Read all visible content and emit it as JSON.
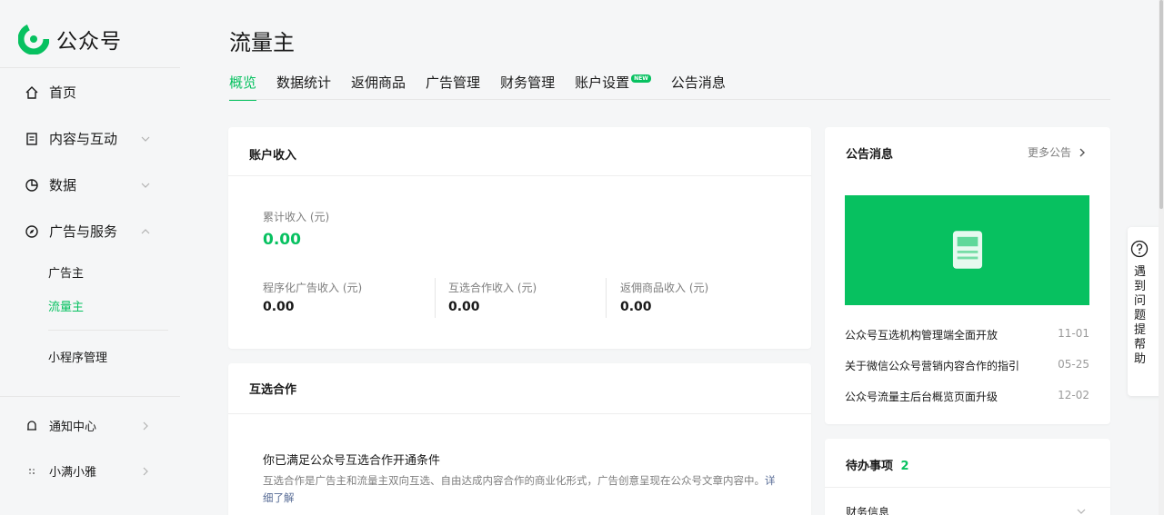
{
  "app": {
    "name": "公众号"
  },
  "sidebar": {
    "items": [
      {
        "label": "首页",
        "icon": "home-icon"
      },
      {
        "label": "内容与互动",
        "icon": "document-icon"
      },
      {
        "label": "数据",
        "icon": "pie-chart-icon"
      },
      {
        "label": "广告与服务",
        "icon": "compass-icon"
      }
    ],
    "sub_items": [
      {
        "label": "广告主",
        "active": false
      },
      {
        "label": "流量主",
        "active": true
      },
      {
        "label": "小程序管理",
        "active": false
      }
    ],
    "bottom_items": [
      {
        "label": "通知中心",
        "icon": "bell-icon"
      },
      {
        "label": "小满小雅",
        "icon": "avatar-icon"
      }
    ]
  },
  "header": {
    "title": "流量主",
    "tabs": [
      {
        "label": "概览",
        "active": true
      },
      {
        "label": "数据统计"
      },
      {
        "label": "返佣商品"
      },
      {
        "label": "广告管理"
      },
      {
        "label": "财务管理"
      },
      {
        "label": "账户设置",
        "badge": "NEW"
      },
      {
        "label": "公告消息"
      }
    ]
  },
  "income": {
    "title": "账户收入",
    "total_label": "累计收入 (元)",
    "total_value": "0.00",
    "items": [
      {
        "label": "程序化广告收入 (元)",
        "value": "0.00"
      },
      {
        "label": "互选合作收入 (元)",
        "value": "0.00"
      },
      {
        "label": "返佣商品收入 (元)",
        "value": "0.00"
      }
    ]
  },
  "mutual": {
    "title": "互选合作",
    "headline": "你已满足公众号互选合作开通条件",
    "desc": "互选合作是广告主和流量主双向互选、自由达成内容合作的商业化形式，广告创意呈现在公众号文章内容中。",
    "link": "详细了解"
  },
  "notices": {
    "title": "公告消息",
    "more": "更多公告",
    "items": [
      {
        "title": "公众号互选机构管理端全面开放",
        "date": "11-01"
      },
      {
        "title": "关于微信公众号营销内容合作的指引",
        "date": "05-25"
      },
      {
        "title": "公众号流量主后台概览页面升级",
        "date": "12-02"
      }
    ]
  },
  "todo": {
    "title": "待办事项",
    "count": "2",
    "first_item": "财务信息"
  },
  "help": {
    "label": "遇到问题 提帮助"
  },
  "colors": {
    "accent": "#07c160",
    "link": "#576b95"
  }
}
